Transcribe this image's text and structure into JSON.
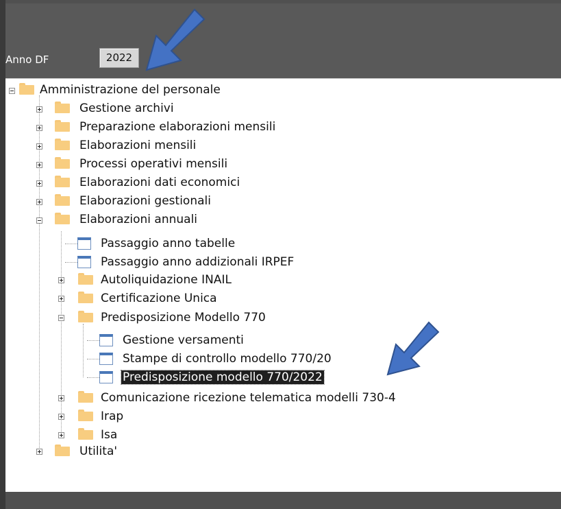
{
  "header": {
    "anno_label": "Anno DF",
    "anno_value": "2022"
  },
  "tree": {
    "root": "Amministrazione del personale",
    "gestione_archivi": "Gestione archivi",
    "preparazione": "Preparazione elaborazioni mensili",
    "elaborazioni_mensili": "Elaborazioni mensili",
    "processi": "Processi operativi mensili",
    "dati_economici": "Elaborazioni dati economici",
    "gestionali": "Elaborazioni gestionali",
    "annuali": "Elaborazioni annuali",
    "passaggio_tabelle": "Passaggio anno tabelle",
    "passaggio_irpef": "Passaggio anno addizionali IRPEF",
    "autoliquidazione": "Autoliquidazione INAIL",
    "certificazione": "Certificazione Unica",
    "predisposizione_770": "Predisposizione Modello 770",
    "gestione_versamenti": "Gestione versamenti",
    "stampe_controllo": "Stampe di controllo modello 770/20",
    "predisposizione_2022": "Predisposizione modello 770/2022",
    "comunicazione": "Comunicazione ricezione telematica modelli 730-4",
    "irap": "Irap",
    "isa": "Isa",
    "utilita": "Utilita'"
  },
  "colors": {
    "arrow": "#4472c4",
    "folder": "#f8cd80",
    "selection": "#1f1f1f"
  }
}
